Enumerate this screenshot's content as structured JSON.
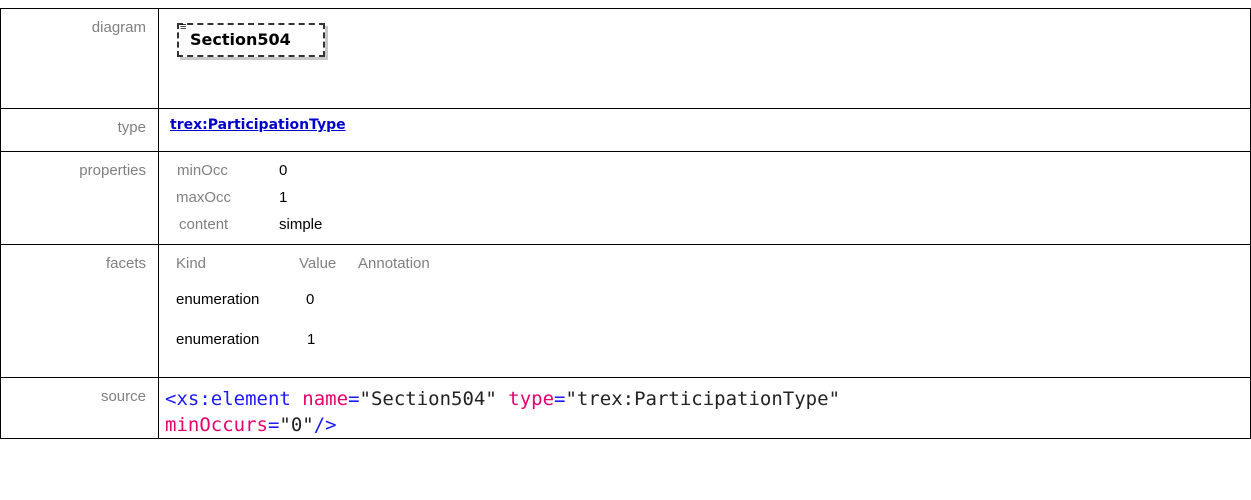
{
  "rows": {
    "diagram": {
      "label": "diagram",
      "element_name": "Section504",
      "icon": "list-lines-icon"
    },
    "type": {
      "label": "type",
      "link": "trex:ParticipationType"
    },
    "properties": {
      "label": "properties",
      "items": [
        {
          "key": "minOcc",
          "value": "0"
        },
        {
          "key": "maxOcc",
          "value": "1"
        },
        {
          "key": "content",
          "value": "simple"
        }
      ]
    },
    "facets": {
      "label": "facets",
      "headers": [
        "Kind",
        "Value",
        "Annotation"
      ],
      "items": [
        {
          "kind": "enumeration",
          "value": "0"
        },
        {
          "kind": "enumeration",
          "value": "1"
        }
      ]
    },
    "source": {
      "label": "source",
      "line1": {
        "open": "<xs:element",
        "attr1": "name",
        "eq": "=",
        "val1": "\"Section504\"",
        "attr2": "type",
        "val2": "\"trex:ParticipationType\""
      },
      "line2": {
        "attr": "minOccurs",
        "val": "\"0\"",
        "close": "/>"
      }
    }
  },
  "colors": {
    "label_gray": "#808080",
    "link": "#0000cc",
    "xml_tag": "#1a1aff",
    "xml_attr": "#e6006e"
  }
}
